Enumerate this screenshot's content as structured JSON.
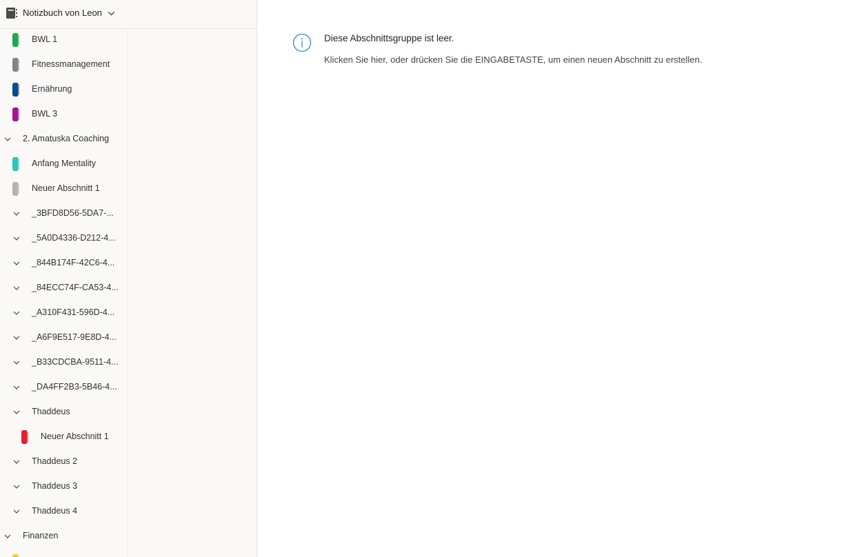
{
  "notebook": {
    "title": "Notizbuch von Leon",
    "icon": "notebook-icon",
    "dropdown_icon": "chevron-down-icon"
  },
  "sections": [
    {
      "type": "section",
      "label": "BWL 1",
      "color": "#1fa94e",
      "level": 0
    },
    {
      "type": "section",
      "label": "Fitnessmanagement",
      "color": "#7d868c",
      "level": 0
    },
    {
      "type": "section",
      "label": "Ernährung",
      "color": "#0b4a8b",
      "level": 0
    },
    {
      "type": "section",
      "label": "BWL 3",
      "color": "#a4128c",
      "level": 0
    },
    {
      "type": "group",
      "label": "2. Amatuska Coaching",
      "level": 0
    },
    {
      "type": "section",
      "label": "Anfang Mentality",
      "color": "#2ec4b6",
      "level": 0
    },
    {
      "type": "section",
      "label": "Neuer Abschnitt 1",
      "color": "#b5b3b1",
      "level": 0
    },
    {
      "type": "group",
      "label": "_3BFD8D56-5DA7-...",
      "level": 1
    },
    {
      "type": "group",
      "label": "_5A0D4336-D212-4...",
      "level": 1
    },
    {
      "type": "group",
      "label": "_844B174F-42C6-4...",
      "level": 1
    },
    {
      "type": "group",
      "label": "_84ECC74F-CA53-4...",
      "level": 1
    },
    {
      "type": "group",
      "label": "_A310F431-596D-4...",
      "level": 1
    },
    {
      "type": "group",
      "label": "_A6F9E517-9E8D-4...",
      "level": 1
    },
    {
      "type": "group",
      "label": "_B33CDCBA-9511-4...",
      "level": 1
    },
    {
      "type": "group",
      "label": "_DA4FF2B3-5B46-4...",
      "level": 1
    },
    {
      "type": "group",
      "label": "Thaddeus",
      "level": 1
    },
    {
      "type": "section",
      "label": "Neuer Abschnitt 1",
      "color": "#e3202c",
      "level": 1
    },
    {
      "type": "group",
      "label": "Thaddeus 2",
      "level": 1
    },
    {
      "type": "group",
      "label": "Thaddeus 3",
      "level": 1
    },
    {
      "type": "group",
      "label": "Thaddeus 4",
      "level": 1
    },
    {
      "type": "group",
      "label": "Finanzen",
      "level": 0
    },
    {
      "type": "section",
      "label": "",
      "color": "#f2c832",
      "level": 0
    }
  ],
  "content": {
    "info_icon": "info-icon",
    "empty_title": "Diese Abschnittsgruppe ist leer.",
    "empty_message": "Klicken Sie hier, oder drücken Sie die EINGABETASTE, um einen neuen Abschnitt zu erstellen."
  }
}
